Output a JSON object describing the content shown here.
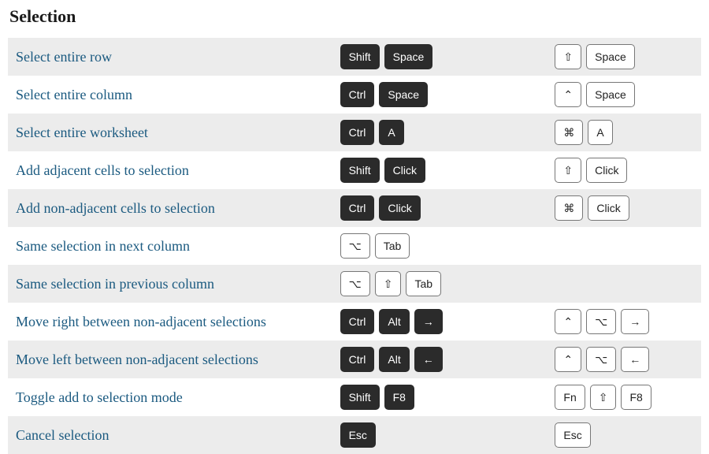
{
  "title": "Selection",
  "key_symbols": {
    "shift": "⇧",
    "ctrl_mac": "⌃",
    "cmd": "⌘",
    "option": "⌥",
    "right": "→",
    "left": "←"
  },
  "rows": [
    {
      "action": "Select entire row",
      "primary": [
        {
          "label": "Shift",
          "style": "dark"
        },
        {
          "label": "Space",
          "style": "dark"
        }
      ],
      "secondary": [
        {
          "label": "⇧",
          "style": "light"
        },
        {
          "label": "Space",
          "style": "light"
        }
      ]
    },
    {
      "action": "Select entire column",
      "primary": [
        {
          "label": "Ctrl",
          "style": "dark"
        },
        {
          "label": "Space",
          "style": "dark"
        }
      ],
      "secondary": [
        {
          "label": "⌃",
          "style": "light"
        },
        {
          "label": "Space",
          "style": "light"
        }
      ]
    },
    {
      "action": "Select entire worksheet",
      "primary": [
        {
          "label": "Ctrl",
          "style": "dark"
        },
        {
          "label": "A",
          "style": "dark"
        }
      ],
      "secondary": [
        {
          "label": "⌘",
          "style": "light"
        },
        {
          "label": "A",
          "style": "light"
        }
      ]
    },
    {
      "action": "Add adjacent cells to selection",
      "primary": [
        {
          "label": "Shift",
          "style": "dark"
        },
        {
          "label": "Click",
          "style": "dark"
        }
      ],
      "secondary": [
        {
          "label": "⇧",
          "style": "light"
        },
        {
          "label": "Click",
          "style": "light"
        }
      ]
    },
    {
      "action": "Add non-adjacent cells to selection",
      "primary": [
        {
          "label": "Ctrl",
          "style": "dark"
        },
        {
          "label": "Click",
          "style": "dark"
        }
      ],
      "secondary": [
        {
          "label": "⌘",
          "style": "light"
        },
        {
          "label": "Click",
          "style": "light"
        }
      ]
    },
    {
      "action": "Same selection in next column",
      "primary": [
        {
          "label": "⌥",
          "style": "light"
        },
        {
          "label": "Tab",
          "style": "light"
        }
      ],
      "secondary": []
    },
    {
      "action": "Same selection in previous column",
      "primary": [
        {
          "label": "⌥",
          "style": "light"
        },
        {
          "label": "⇧",
          "style": "light"
        },
        {
          "label": "Tab",
          "style": "light"
        }
      ],
      "secondary": []
    },
    {
      "action": "Move right between non-adjacent selections",
      "primary": [
        {
          "label": "Ctrl",
          "style": "dark"
        },
        {
          "label": "Alt",
          "style": "dark"
        },
        {
          "label": "→",
          "style": "dark"
        }
      ],
      "secondary": [
        {
          "label": "⌃",
          "style": "light"
        },
        {
          "label": "⌥",
          "style": "light"
        },
        {
          "label": "→",
          "style": "light"
        }
      ]
    },
    {
      "action": "Move left between non-adjacent selections",
      "primary": [
        {
          "label": "Ctrl",
          "style": "dark"
        },
        {
          "label": "Alt",
          "style": "dark"
        },
        {
          "label": "←",
          "style": "dark"
        }
      ],
      "secondary": [
        {
          "label": "⌃",
          "style": "light"
        },
        {
          "label": "⌥",
          "style": "light"
        },
        {
          "label": "←",
          "style": "light"
        }
      ]
    },
    {
      "action": "Toggle add to selection mode",
      "primary": [
        {
          "label": "Shift",
          "style": "dark"
        },
        {
          "label": "F8",
          "style": "dark"
        }
      ],
      "secondary": [
        {
          "label": "Fn",
          "style": "light"
        },
        {
          "label": "⇧",
          "style": "light"
        },
        {
          "label": "F8",
          "style": "light"
        }
      ]
    },
    {
      "action": "Cancel selection",
      "primary": [
        {
          "label": "Esc",
          "style": "dark"
        }
      ],
      "secondary": [
        {
          "label": "Esc",
          "style": "light"
        }
      ]
    }
  ]
}
